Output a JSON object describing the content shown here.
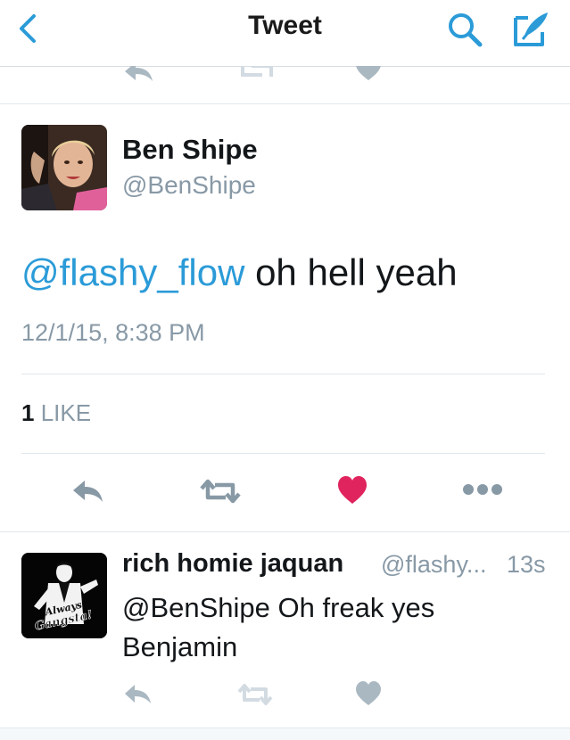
{
  "nav": {
    "title": "Tweet",
    "accent_color": "#2b9bd8",
    "icons": [
      "back-chevron-icon",
      "search-icon",
      "compose-icon"
    ]
  },
  "tweet": {
    "author_name": "Ben Shipe",
    "author_handle": "@BenShipe",
    "mention": "@flashy_flow",
    "text": " oh hell yeah",
    "timestamp": "12/1/15, 8:38 PM",
    "likes_count": "1",
    "likes_label": "LIKE",
    "liked": true,
    "like_color": "#e0245e",
    "action_icons": [
      "reply-icon",
      "retweet-icon",
      "heart-icon",
      "more-icon"
    ]
  },
  "reply": {
    "author_name": "rich homie jaquan",
    "author_handle": "@flashy...",
    "time": "13s",
    "text": "@BenShipe Oh freak yes Benjamin",
    "avatar_text_line1": "Always",
    "avatar_text_line2": "Gangsta!"
  }
}
